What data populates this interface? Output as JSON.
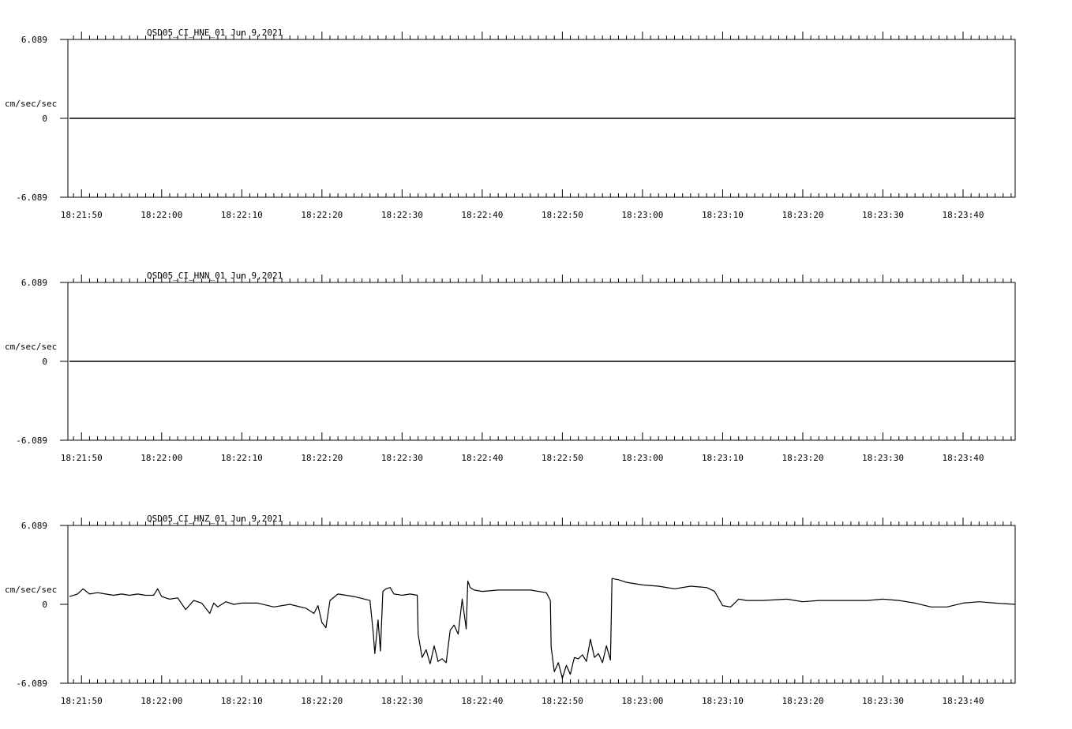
{
  "chart_data": [
    {
      "type": "line",
      "title": "QSD05_CI_HNE_01  Jun 9,2021",
      "ylabel": "cm/sec/sec",
      "ytick_labels": [
        "6.089",
        "0",
        "-6.089"
      ],
      "ylim": [
        -6.089,
        6.089
      ],
      "xlim": [
        -1.7,
        116.5
      ],
      "x_unit": "seconds after 18:21:50",
      "xtick_labels": [
        "18:21:50",
        "18:22:00",
        "18:22:10",
        "18:22:20",
        "18:22:30",
        "18:22:40",
        "18:22:50",
        "18:23:00",
        "18:23:10",
        "18:23:20",
        "18:23:30",
        "18:23:40"
      ],
      "xtick_values": [
        0,
        10,
        20,
        30,
        40,
        50,
        60,
        70,
        80,
        90,
        100,
        110
      ],
      "grid": false,
      "series": [
        {
          "x": [
            -1.5,
            116.5
          ],
          "y": [
            0,
            0
          ]
        }
      ]
    },
    {
      "type": "line",
      "title": "QSD05_CI_HNN_01  Jun 9,2021",
      "ylabel": "cm/sec/sec",
      "ytick_labels": [
        "6.089",
        "0",
        "-6.089"
      ],
      "ylim": [
        -6.089,
        6.089
      ],
      "xlim": [
        -1.7,
        116.5
      ],
      "x_unit": "seconds after 18:21:50",
      "xtick_labels": [
        "18:21:50",
        "18:22:00",
        "18:22:10",
        "18:22:20",
        "18:22:30",
        "18:22:40",
        "18:22:50",
        "18:23:00",
        "18:23:10",
        "18:23:20",
        "18:23:30",
        "18:23:40"
      ],
      "xtick_values": [
        0,
        10,
        20,
        30,
        40,
        50,
        60,
        70,
        80,
        90,
        100,
        110
      ],
      "grid": false,
      "series": [
        {
          "x": [
            -1.5,
            116.5
          ],
          "y": [
            0,
            0
          ]
        }
      ]
    },
    {
      "type": "line",
      "title": "QSD05_CI_HNZ_01  Jun 9,2021",
      "ylabel": "cm/sec/sec",
      "ytick_labels": [
        "6.089",
        "0",
        "-6.089"
      ],
      "ylim": [
        -6.089,
        6.089
      ],
      "xlim": [
        -1.7,
        116.5
      ],
      "x_unit": "seconds after 18:21:50",
      "xtick_labels": [
        "18:21:50",
        "18:22:00",
        "18:22:10",
        "18:22:20",
        "18:22:30",
        "18:22:40",
        "18:22:50",
        "18:23:00",
        "18:23:10",
        "18:23:20",
        "18:23:30",
        "18:23:40"
      ],
      "xtick_values": [
        0,
        10,
        20,
        30,
        40,
        50,
        60,
        70,
        80,
        90,
        100,
        110
      ],
      "grid": false,
      "series": [
        {
          "x": [
            -1.5,
            -0.5,
            0.2,
            1.0,
            2.0,
            3.0,
            4.0,
            5.0,
            6.0,
            7.0,
            8.0,
            9.0,
            9.5,
            10.0,
            11.0,
            12.0,
            13.0,
            14.0,
            15.0,
            16.0,
            16.5,
            17.0,
            18.0,
            19.0,
            20.0,
            22.0,
            24.0,
            26.0,
            28.0,
            29.0,
            29.5,
            30.0,
            30.5,
            31.0,
            32.0,
            34.0,
            36.0,
            36.4,
            36.6,
            37.0,
            37.3,
            37.6,
            38.0,
            38.5,
            39.0,
            40.0,
            41.0,
            41.9,
            42.0,
            42.5,
            43.0,
            43.5,
            44.0,
            44.5,
            45.0,
            45.5,
            46.0,
            46.5,
            47.0,
            47.5,
            48.0,
            48.2,
            48.5,
            49.0,
            50.0,
            52.0,
            54.0,
            56.0,
            58.0,
            58.5,
            58.6,
            59.0,
            59.5,
            60.0,
            60.5,
            61.0,
            61.5,
            62.0,
            62.5,
            63.0,
            63.5,
            64.0,
            64.5,
            65.0,
            65.5,
            66.0,
            66.2,
            67.0,
            68.0,
            70.0,
            72.0,
            74.0,
            76.0,
            78.0,
            79.0,
            80.0,
            81.0,
            82.0,
            83.0,
            85.0,
            88.0,
            90.0,
            92.0,
            95.0,
            98.0,
            100.0,
            102.0,
            104.0,
            106.0,
            108.0,
            110.0,
            112.0,
            114.0,
            116.5
          ],
          "y": [
            0.6,
            0.8,
            1.2,
            0.8,
            0.9,
            0.8,
            0.7,
            0.8,
            0.7,
            0.8,
            0.7,
            0.7,
            1.2,
            0.6,
            0.4,
            0.5,
            -0.4,
            0.3,
            0.1,
            -0.7,
            0.1,
            -0.2,
            0.2,
            0.0,
            0.1,
            0.1,
            -0.2,
            0.0,
            -0.3,
            -0.7,
            -0.1,
            -1.4,
            -1.8,
            0.3,
            0.8,
            0.6,
            0.3,
            -2.2,
            -3.8,
            -1.2,
            -3.6,
            1.0,
            1.2,
            1.3,
            0.8,
            0.7,
            0.8,
            0.7,
            -2.3,
            -4.1,
            -3.5,
            -4.6,
            -3.2,
            -4.4,
            -4.2,
            -4.5,
            -2.0,
            -1.6,
            -2.3,
            0.4,
            -1.9,
            1.8,
            1.3,
            1.1,
            1.0,
            1.1,
            1.1,
            1.1,
            0.9,
            0.3,
            -3.3,
            -5.2,
            -4.5,
            -5.7,
            -4.7,
            -5.4,
            -4.1,
            -4.2,
            -3.9,
            -4.4,
            -2.7,
            -4.1,
            -3.8,
            -4.5,
            -3.2,
            -4.3,
            2.0,
            1.9,
            1.7,
            1.5,
            1.4,
            1.2,
            1.4,
            1.3,
            1.0,
            -0.1,
            -0.2,
            0.4,
            0.3,
            0.3,
            0.4,
            0.2,
            0.3,
            0.3,
            0.3,
            0.4,
            0.3,
            0.1,
            -0.2,
            -0.2,
            0.1,
            0.2,
            0.1,
            0.0
          ]
        }
      ]
    }
  ]
}
